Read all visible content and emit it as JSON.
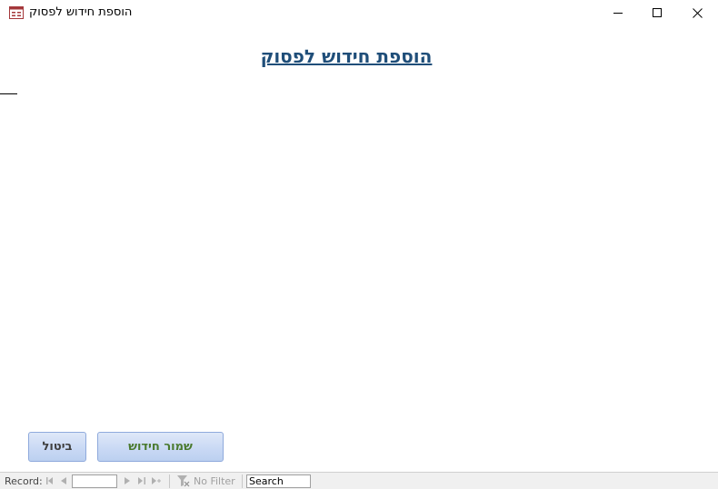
{
  "window": {
    "title": "הוספת חידוש לפסוק",
    "icon": "form-icon",
    "controls": [
      "minimize-icon",
      "maximize-icon",
      "close-icon"
    ]
  },
  "form": {
    "heading": "הוספת חידוש לפסוק",
    "heading_color": "#1f4e79"
  },
  "buttons": {
    "cancel_label": "ביטול",
    "save_label": "שמור חידוש",
    "save_text_color": "#4a7a2e"
  },
  "navigation": {
    "record_label": "Record:",
    "record_value": "",
    "filter_label": "No Filter",
    "search_placeholder": "Search"
  }
}
